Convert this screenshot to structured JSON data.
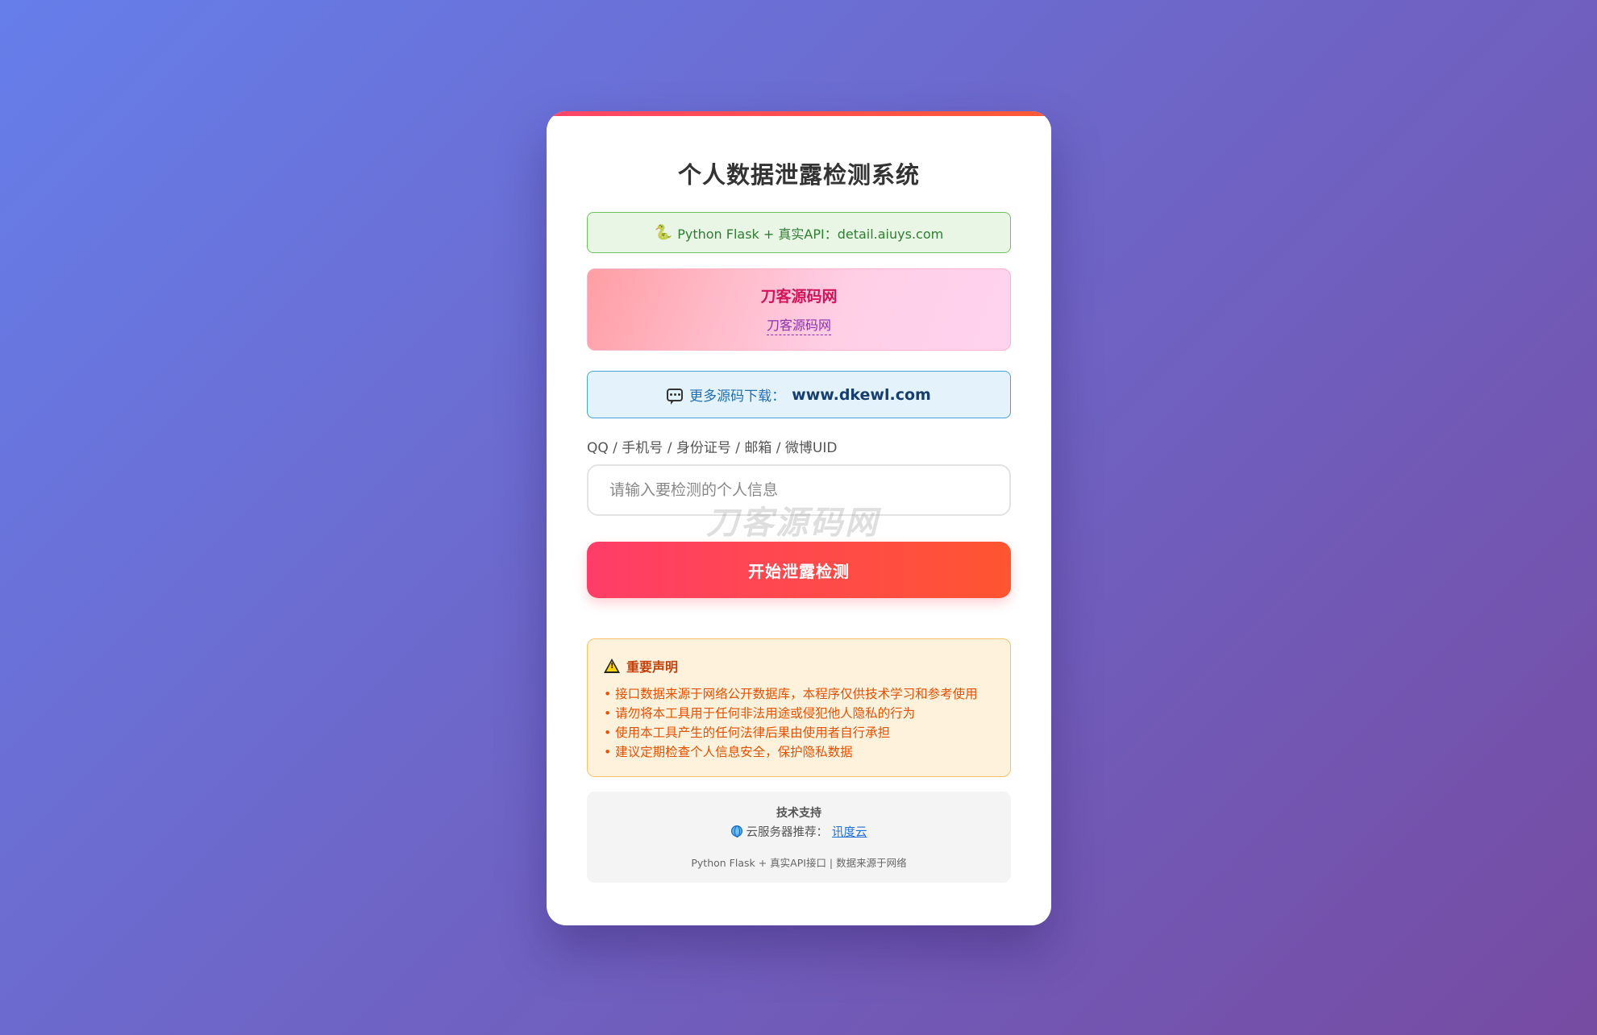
{
  "title": "个人数据泄露检测系统",
  "api_banner": {
    "icon": "snake-icon",
    "text": "Python Flask + 真实API：detail.aiuys.com"
  },
  "brand": {
    "name": "刀客源码网",
    "link_text": "刀客源码网"
  },
  "download": {
    "icon": "speech-bubble-icon",
    "prefix": "更多源码下载：",
    "url": "www.dkewl.com"
  },
  "form": {
    "label": "QQ / 手机号 / 身份证号 / 邮箱 / 微博UID",
    "placeholder": "请输入要检测的个人信息",
    "watermark": "刀客源码网",
    "submit_label": "开始泄露检测"
  },
  "notice": {
    "icon": "warning-icon",
    "title": "重要声明",
    "items": [
      "接口数据来源于网络公开数据库，本程序仅供技术学习和参考使用",
      "请勿将本工具用于任何非法用途或侵犯他人隐私的行为",
      "使用本工具产生的任何法律后果由使用者自行承担",
      "建议定期检查个人信息安全，保护隐私数据"
    ]
  },
  "support": {
    "title": "技术支持",
    "icon": "globe-icon",
    "recommend_prefix": "云服务器推荐：",
    "recommend_link": "讯度云",
    "footer": "Python Flask + 真实API接口 | 数据来源于网络"
  },
  "colors": {
    "bg_start": "#667eea",
    "bg_end": "#764ba2",
    "accent": "#ff4a4a",
    "brand": "#d4145a"
  }
}
